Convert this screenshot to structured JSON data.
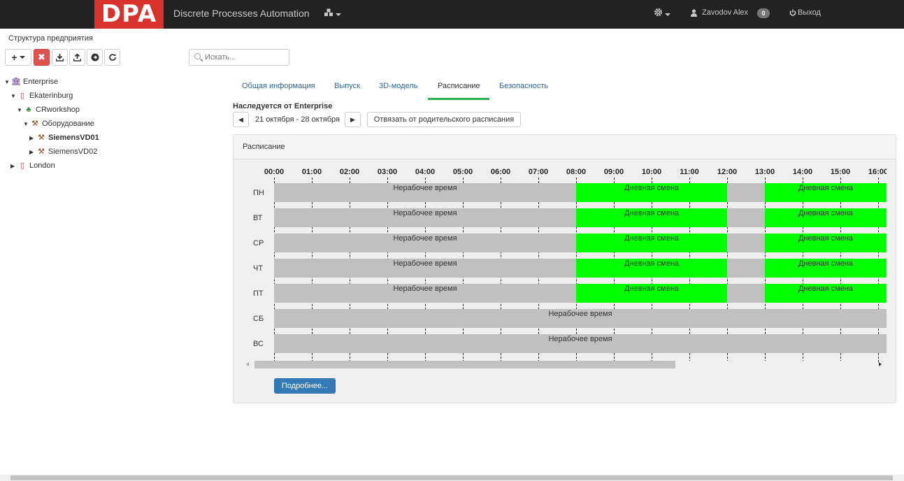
{
  "navbar": {
    "logo": "DPA",
    "brand": "Discrete Processes Automation",
    "user": "Zavodov Alex",
    "notifications": "0",
    "logout": "Выход",
    "icons": [
      "cubes-icon",
      "gear-icon",
      "user-icon",
      "power-icon"
    ]
  },
  "sidebar": {
    "title": "Структура предприятия",
    "toolbar": [
      "add-dropdown",
      "delete",
      "download",
      "upload",
      "go",
      "refresh"
    ],
    "tree": [
      {
        "label": "Enterprise",
        "icon": "bank-icon",
        "expanded": true
      },
      {
        "label": "Ekaterinburg",
        "icon": "building-icon",
        "expanded": true
      },
      {
        "label": "CRworkshop",
        "icon": "sitemap-icon",
        "expanded": true
      },
      {
        "label": "Оборудование",
        "icon": "gavel-icon",
        "expanded": true
      },
      {
        "label": "SiemensVD01",
        "icon": "gavel-icon",
        "expanded": false,
        "selected": true
      },
      {
        "label": "SiemensVD02",
        "icon": "gavel-icon",
        "expanded": false
      },
      {
        "label": "London",
        "icon": "building-icon",
        "expanded": false
      }
    ]
  },
  "search": {
    "placeholder": "Искать..."
  },
  "tabs": [
    "Общая информация",
    "Выпуск",
    "3D-модель",
    "Расписание",
    "Безопасность"
  ],
  "active_tab": "Расписание",
  "schedule": {
    "inherited": "Наследуется от Enterprise",
    "week": "21 октября - 28 октября",
    "detach_button": "Отвязать от родительского расписания",
    "panel_title": "Расписание",
    "hours": [
      "00:00",
      "01:00",
      "02:00",
      "03:00",
      "04:00",
      "05:00",
      "06:00",
      "07:00",
      "08:00",
      "09:00",
      "10:00",
      "11:00",
      "12:00",
      "13:00",
      "14:00",
      "15:00",
      "16:00"
    ],
    "days": [
      {
        "label": "ПН",
        "segments": [
          {
            "text": "Нерабочее время",
            "type": "off",
            "start": 0,
            "end": 8
          },
          {
            "text": "Дневная смена",
            "type": "on",
            "start": 8,
            "end": 12
          },
          {
            "text": "",
            "type": "off",
            "start": 12,
            "end": 13
          },
          {
            "text": "Дневная смена",
            "type": "on",
            "start": 13,
            "end": 17
          }
        ]
      },
      {
        "label": "ВТ",
        "segments": [
          {
            "text": "Нерабочее время",
            "type": "off",
            "start": 0,
            "end": 8
          },
          {
            "text": "Дневная смена",
            "type": "on",
            "start": 8,
            "end": 12
          },
          {
            "text": "",
            "type": "off",
            "start": 12,
            "end": 13
          },
          {
            "text": "Дневная смена",
            "type": "on",
            "start": 13,
            "end": 17
          }
        ]
      },
      {
        "label": "СР",
        "segments": [
          {
            "text": "Нерабочее время",
            "type": "off",
            "start": 0,
            "end": 8
          },
          {
            "text": "Дневная смена",
            "type": "on",
            "start": 8,
            "end": 12
          },
          {
            "text": "",
            "type": "off",
            "start": 12,
            "end": 13
          },
          {
            "text": "Дневная смена",
            "type": "on",
            "start": 13,
            "end": 17
          }
        ]
      },
      {
        "label": "ЧТ",
        "segments": [
          {
            "text": "Нерабочее время",
            "type": "off",
            "start": 0,
            "end": 8
          },
          {
            "text": "Дневная смена",
            "type": "on",
            "start": 8,
            "end": 12
          },
          {
            "text": "",
            "type": "off",
            "start": 12,
            "end": 13
          },
          {
            "text": "Дневная смена",
            "type": "on",
            "start": 13,
            "end": 17
          }
        ]
      },
      {
        "label": "ПТ",
        "segments": [
          {
            "text": "Нерабочее время",
            "type": "off",
            "start": 0,
            "end": 8
          },
          {
            "text": "Дневная смена",
            "type": "on",
            "start": 8,
            "end": 12
          },
          {
            "text": "",
            "type": "off",
            "start": 12,
            "end": 13
          },
          {
            "text": "Дневная смена",
            "type": "on",
            "start": 13,
            "end": 17
          }
        ]
      },
      {
        "label": "СБ",
        "segments": [
          {
            "text": "Нерабочее время",
            "type": "off",
            "start": 0,
            "end": 24
          }
        ]
      },
      {
        "label": "ВС",
        "segments": [
          {
            "text": "Нерабочее время",
            "type": "off",
            "start": 0,
            "end": 24
          }
        ]
      }
    ],
    "more_button": "Подробнее..."
  },
  "colors": {
    "navbar": "#222222",
    "logo": "#d9322c",
    "work": "#00ff00",
    "off": "#c0c0c0",
    "primary": "#337ab7",
    "tab_underline": "#2ab050"
  }
}
